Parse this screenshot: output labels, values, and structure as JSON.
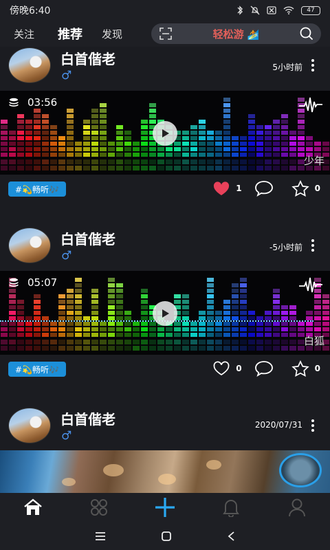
{
  "status_bar": {
    "time": "傍晚6:40",
    "battery": "47"
  },
  "header": {
    "tabs": [
      {
        "label": "关注"
      },
      {
        "label": "推荐"
      },
      {
        "label": "发现"
      }
    ],
    "search_text": "轻松游",
    "search_emoji": "🏄"
  },
  "posts": [
    {
      "username": "白首偕老",
      "gender": "♂",
      "time": "5小时前",
      "duration": "03:56",
      "song": "少年",
      "tag": "#💫畅听🎶",
      "likes": "1",
      "favorites": "0",
      "liked": true
    },
    {
      "username": "白首偕老",
      "gender": "♂",
      "time": "-5小时前",
      "duration": "05:07",
      "song": "白狐",
      "tag": "#💫畅听🎶",
      "likes": "0",
      "favorites": "0",
      "liked": false
    },
    {
      "username": "白首偕老",
      "gender": "♂",
      "time": "2020/07/31"
    }
  ],
  "colors": {
    "accent": "#1c8fd9",
    "like": "#e8415a",
    "add": "#2aa8f2"
  },
  "bottom_nav": [
    "home-icon",
    "discover-icon",
    "add-icon",
    "bell-icon",
    "profile-icon"
  ]
}
